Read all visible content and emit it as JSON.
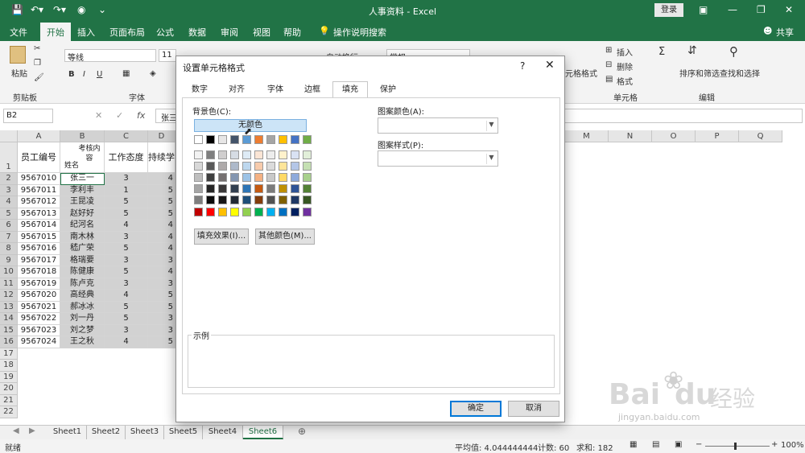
{
  "window": {
    "title": "人事资料 - Excel",
    "login_label": "登录",
    "share_label": "共享"
  },
  "ribbon_tabs": [
    "文件",
    "开始",
    "插入",
    "页面布局",
    "公式",
    "数据",
    "审阅",
    "视图",
    "帮助",
    "操作说明搜索"
  ],
  "ribbon": {
    "paste": "粘贴",
    "clipboard": "剪贴板",
    "font_name": "等线",
    "font_size": "11",
    "font_group": "字体",
    "wrap": "自动换行",
    "number_format": "常规",
    "table_format": "元格格式",
    "insert": "插入",
    "delete": "删除",
    "format": "格式",
    "cells_group": "单元格",
    "sort": "排序和筛选",
    "find": "查找和选择",
    "edit_group": "编辑",
    "bold": "B",
    "italic": "I",
    "underline": "U"
  },
  "formula_bar": {
    "name_box": "B2",
    "fx": "fx",
    "content": "张三"
  },
  "columns": [
    {
      "letter": "A",
      "width": 53
    },
    {
      "letter": "B",
      "width": 55
    },
    {
      "letter": "C",
      "width": 54
    },
    {
      "letter": "D",
      "width": 30
    },
    {
      "letter": "M",
      "width": 52
    },
    {
      "letter": "N",
      "width": 54
    },
    {
      "letter": "O",
      "width": 54
    },
    {
      "letter": "P",
      "width": 54
    },
    {
      "letter": "Q",
      "width": 54
    }
  ],
  "headers": {
    "a": "员工编号",
    "b_top": "考核内容",
    "b_bottom": "姓名",
    "c": "工作态度",
    "d": "持续学"
  },
  "rows": [
    {
      "id": "9567010",
      "name": "张三一",
      "c": "3",
      "d": "4"
    },
    {
      "id": "9567011",
      "name": "李利丰",
      "c": "1",
      "d": "5"
    },
    {
      "id": "9567012",
      "name": "王昆凌",
      "c": "5",
      "d": "5"
    },
    {
      "id": "9567013",
      "name": "赵好好",
      "c": "5",
      "d": "5"
    },
    {
      "id": "9567014",
      "name": "纪河名",
      "c": "4",
      "d": "4"
    },
    {
      "id": "9567015",
      "name": "南木林",
      "c": "3",
      "d": "4"
    },
    {
      "id": "9567016",
      "name": "嵇广荣",
      "c": "5",
      "d": "4"
    },
    {
      "id": "9567017",
      "name": "格瑞要",
      "c": "3",
      "d": "3"
    },
    {
      "id": "9567018",
      "name": "陈健康",
      "c": "5",
      "d": "4"
    },
    {
      "id": "9567019",
      "name": "陈卢克",
      "c": "3",
      "d": "3"
    },
    {
      "id": "9567020",
      "name": "高经典",
      "c": "4",
      "d": "5"
    },
    {
      "id": "9567021",
      "name": "郝冰冰",
      "c": "5",
      "d": "5"
    },
    {
      "id": "9567022",
      "name": "刘一丹",
      "c": "5",
      "d": "3"
    },
    {
      "id": "9567023",
      "name": "刘之梦",
      "c": "3",
      "d": "3"
    },
    {
      "id": "9567024",
      "name": "王之秋",
      "c": "4",
      "d": "5"
    }
  ],
  "row_numbers": [
    "1",
    "2",
    "3",
    "4",
    "5",
    "6",
    "7",
    "8",
    "9",
    "10",
    "11",
    "12",
    "13",
    "14",
    "15",
    "16",
    "17",
    "18",
    "19",
    "20",
    "21",
    "22"
  ],
  "sheets": [
    "Sheet1",
    "Sheet2",
    "Sheet3",
    "Sheet5",
    "Sheet4",
    "Sheet6"
  ],
  "active_sheet": "Sheet6",
  "status": {
    "ready": "就绪",
    "average": "平均值: 4.044444444",
    "count": "计数: 60",
    "sum": "求和: 182",
    "zoom": "100%"
  },
  "dialog": {
    "title": "设置单元格格式",
    "help": "?",
    "tabs": [
      "数字",
      "对齐",
      "字体",
      "边框",
      "填充",
      "保护"
    ],
    "active_tab": "填充",
    "bg_color_label": "背景色(C):",
    "no_color": "无颜色",
    "pattern_color_label": "图案颜色(A):",
    "pattern_style_label": "图案样式(P):",
    "fill_effects": "填充效果(I)...",
    "more_colors": "其他颜色(M)...",
    "example_label": "示例",
    "ok": "确定",
    "cancel": "取消"
  },
  "palette": {
    "theme_top": [
      "#ffffff",
      "#000000",
      "#e7e6e6",
      "#44546a",
      "#5b9bd5",
      "#ed7d31",
      "#a5a5a5",
      "#ffc000",
      "#4472c4",
      "#70ad47"
    ],
    "theme_rows": [
      [
        "#f2f2f2",
        "#7f7f7f",
        "#d0cece",
        "#d6dce4",
        "#deebf6",
        "#fbe5d5",
        "#ededed",
        "#fff2cc",
        "#d9e2f3",
        "#e2efd9"
      ],
      [
        "#d8d8d8",
        "#595959",
        "#aeaaaa",
        "#adb9ca",
        "#bdd7ee",
        "#f7cbac",
        "#dbdbdb",
        "#fee599",
        "#b4c6e7",
        "#c5e0b3"
      ],
      [
        "#bfbfbf",
        "#3f3f3f",
        "#757070",
        "#8496b0",
        "#9dc3e6",
        "#f4b183",
        "#c9c9c9",
        "#ffd965",
        "#8eaadb",
        "#a8d08d"
      ],
      [
        "#a5a5a5",
        "#262626",
        "#3a3838",
        "#323f4f",
        "#2e75b5",
        "#c55a11",
        "#7b7b7b",
        "#bf9000",
        "#2f5496",
        "#538135"
      ],
      [
        "#7f7f7f",
        "#0c0c0c",
        "#171616",
        "#222a35",
        "#1e4e79",
        "#833c0b",
        "#525252",
        "#7f6000",
        "#1f3864",
        "#375623"
      ]
    ],
    "standard": [
      "#c00000",
      "#ff0000",
      "#ffc000",
      "#ffff00",
      "#92d050",
      "#00b050",
      "#00b0f0",
      "#0070c0",
      "#002060",
      "#7030a0"
    ]
  },
  "watermark": {
    "brand": "Bai",
    "paw": "du",
    "suffix": "经验",
    "url": "jingyan.baidu.com"
  }
}
